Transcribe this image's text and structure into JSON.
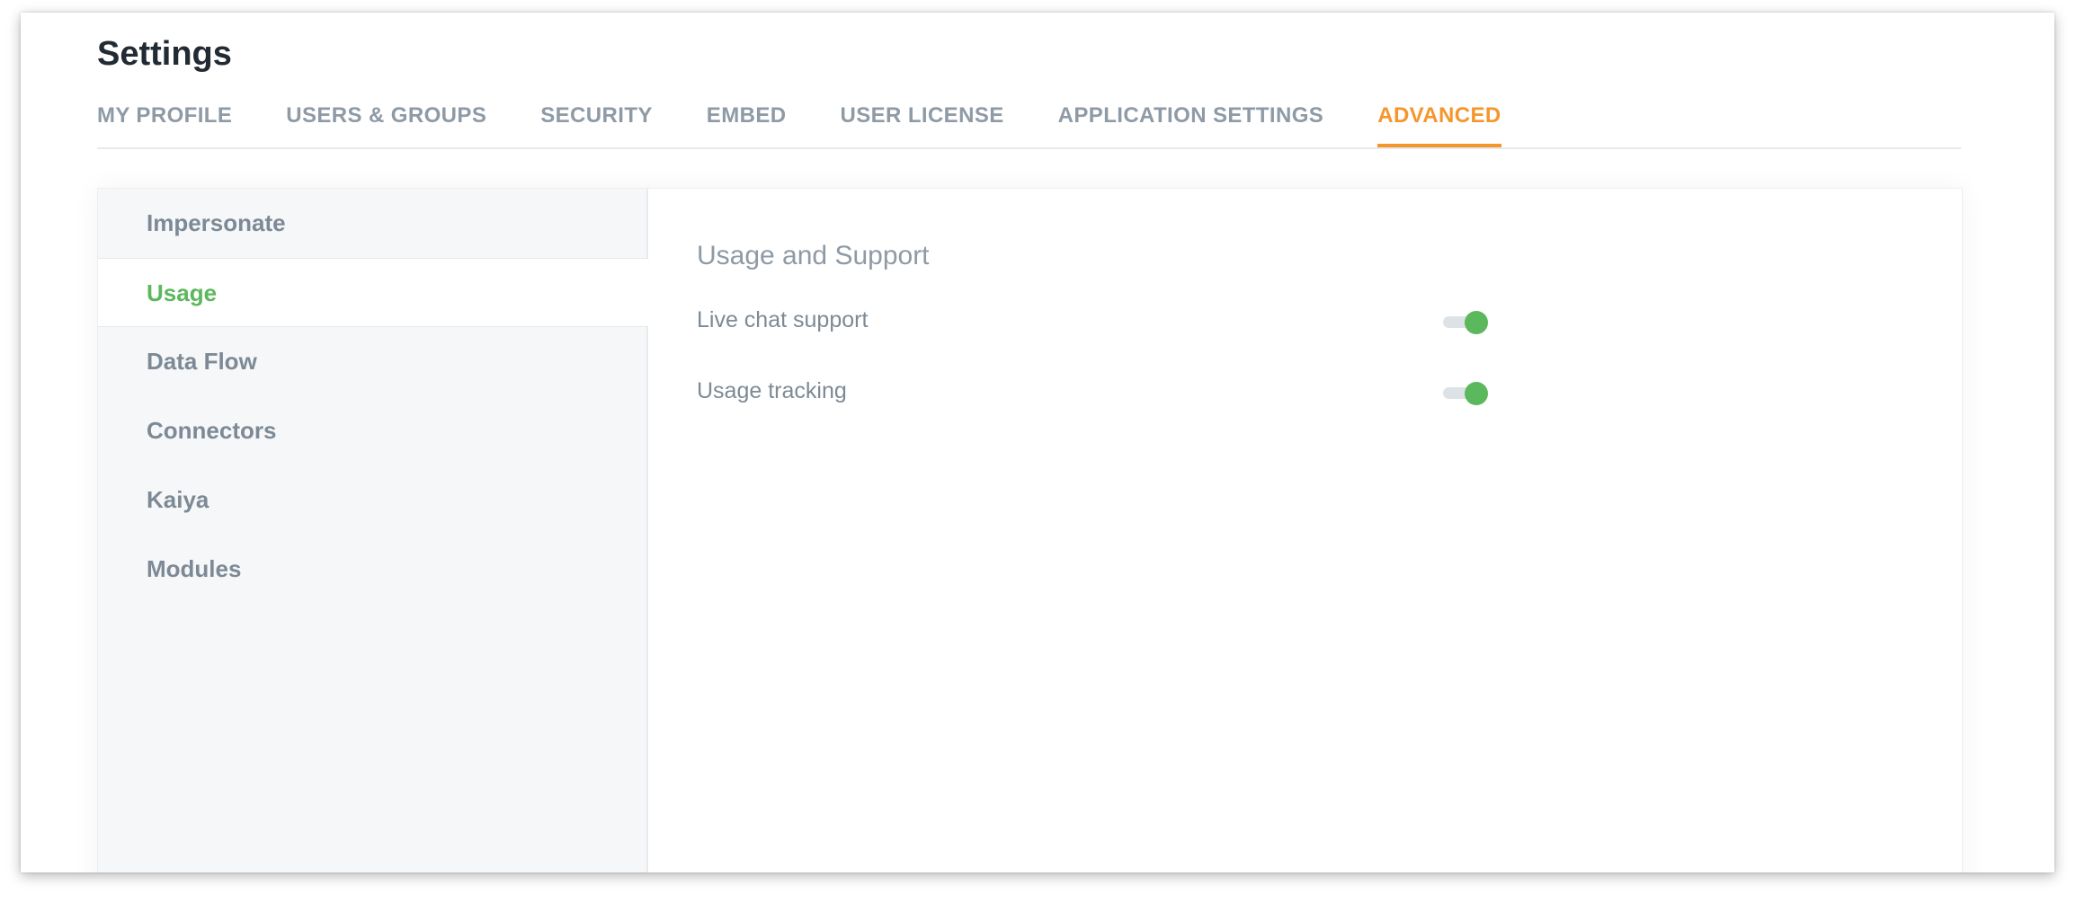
{
  "page": {
    "title": "Settings"
  },
  "tabs": [
    {
      "label": "MY PROFILE",
      "active": false
    },
    {
      "label": "USERS & GROUPS",
      "active": false
    },
    {
      "label": "SECURITY",
      "active": false
    },
    {
      "label": "EMBED",
      "active": false
    },
    {
      "label": "USER LICENSE",
      "active": false
    },
    {
      "label": "APPLICATION SETTINGS",
      "active": false
    },
    {
      "label": "ADVANCED",
      "active": true
    }
  ],
  "sidebar": {
    "items": [
      {
        "label": "Impersonate",
        "active": false
      },
      {
        "label": "Usage",
        "active": true
      },
      {
        "label": "Data Flow",
        "active": false
      },
      {
        "label": "Connectors",
        "active": false
      },
      {
        "label": "Kaiya",
        "active": false
      },
      {
        "label": "Modules",
        "active": false
      }
    ]
  },
  "section": {
    "title": "Usage and Support",
    "settings": [
      {
        "label": "Live chat support",
        "enabled": true
      },
      {
        "label": "Usage tracking",
        "enabled": true
      }
    ]
  },
  "colors": {
    "accent_orange": "#f5962d",
    "active_green": "#5cb85c",
    "muted_text": "#8e9aa5",
    "title_text": "#222a33"
  }
}
